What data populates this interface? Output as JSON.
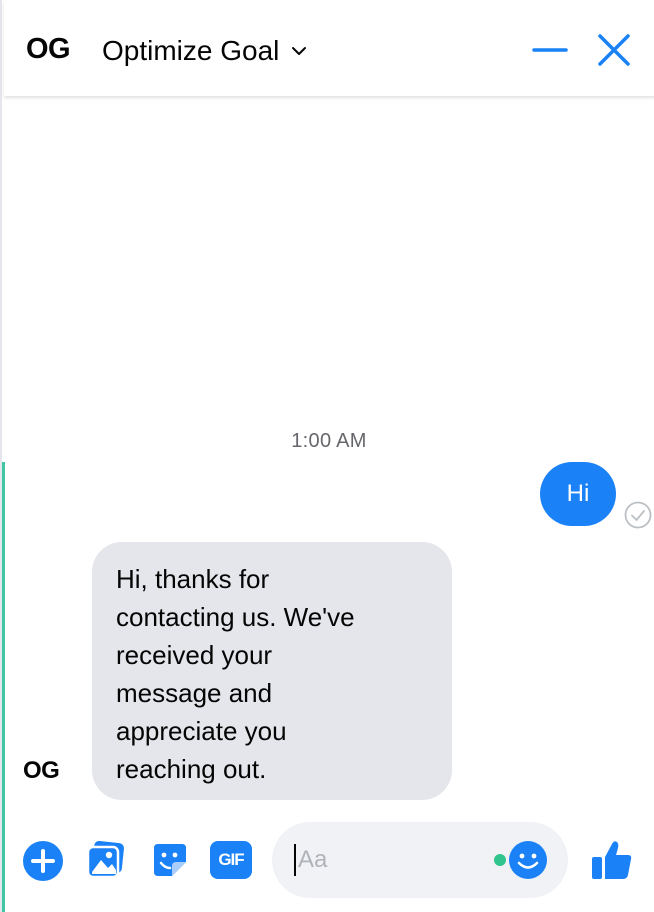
{
  "header": {
    "logo_text": "OG",
    "title": "Optimize Goal"
  },
  "conversation": {
    "timestamp": "1:00 AM",
    "outgoing_message": "Hi",
    "incoming_avatar_text": "OG",
    "incoming_lines": [
      "Hi, thanks for",
      "contacting us. We've",
      "received your",
      "message and",
      "appreciate you",
      "reaching out."
    ]
  },
  "composer": {
    "placeholder": "Aa",
    "gif_label": "GIF"
  },
  "colors": {
    "accent_blue": "#1a81f7",
    "incoming_bubble": "#e4e6eb",
    "input_bg": "#f0f2f5",
    "status_green": "#31c48d",
    "left_accent": "#3fc6a4"
  },
  "icons": [
    "chevron-down-icon",
    "minimize-icon",
    "close-icon",
    "seen-check-icon",
    "plus-icon",
    "photo-icon",
    "sticker-icon",
    "gif-icon",
    "emoji-icon",
    "thumbs-up-icon"
  ]
}
